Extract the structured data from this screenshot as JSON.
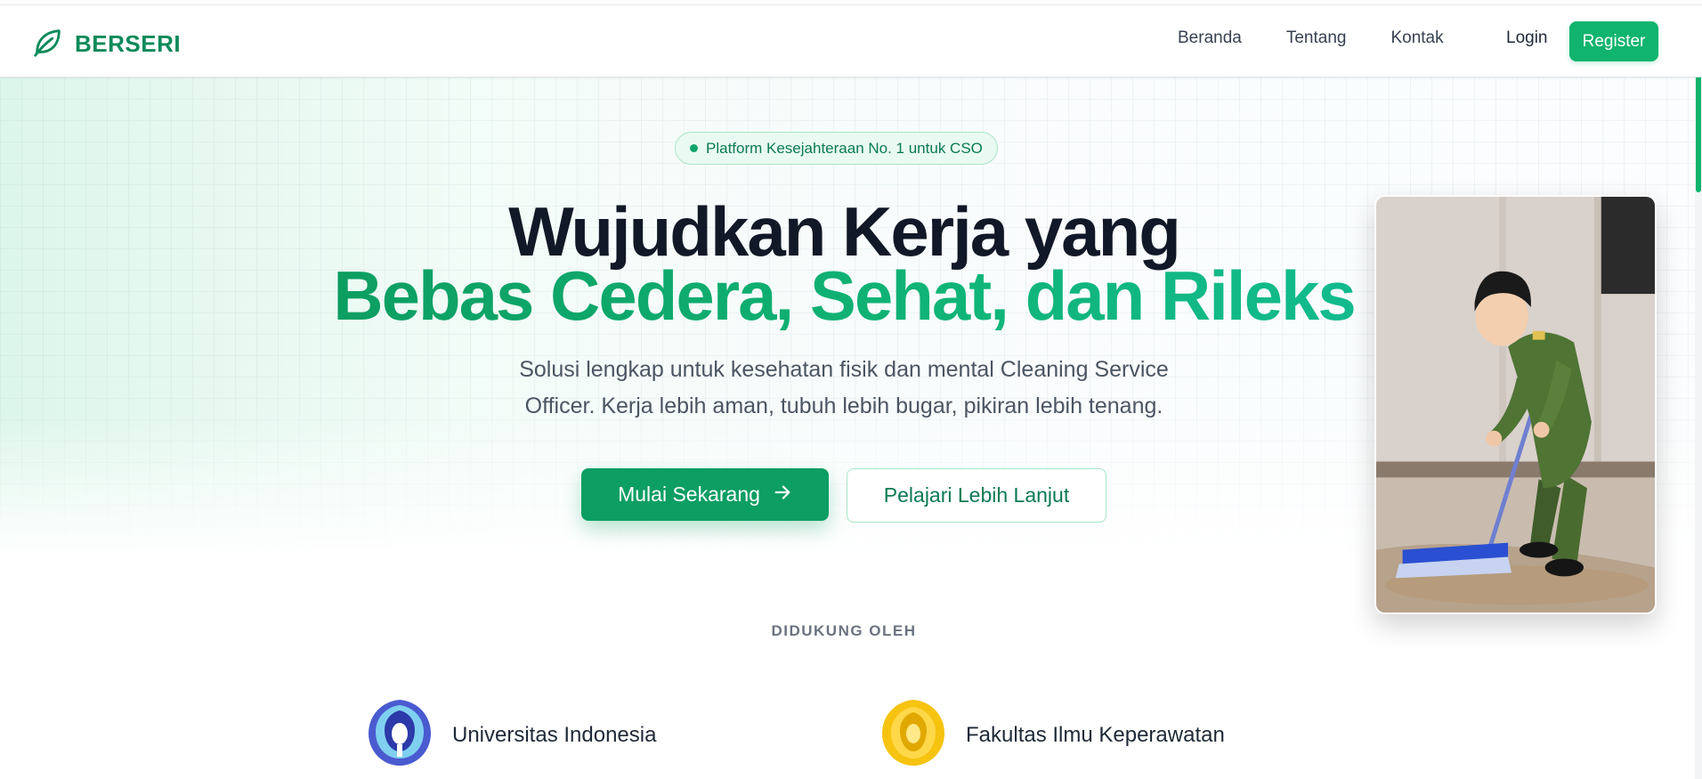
{
  "brand": {
    "name": "BERSERI",
    "icon": "leaf-icon"
  },
  "nav": {
    "links": [
      "Beranda",
      "Tentang",
      "Kontak"
    ],
    "login": "Login",
    "register": "Register"
  },
  "hero": {
    "badge": "Platform Kesejahteraan No. 1 untuk CSO",
    "headline_line1": "Wujudkan Kerja yang",
    "headline_line2": "Bebas Cedera, Sehat, dan Rileks",
    "subtitle": "Solusi lengkap untuk kesehatan fisik dan mental Cleaning Service Officer. Kerja lebih aman, tubuh lebih bugar, pikiran lebih tenang.",
    "primary_cta": "Mulai Sekarang",
    "primary_cta_icon": "arrow-right-icon",
    "secondary_cta": "Pelajari Lebih Lanjut",
    "illustration": "cleaning-officer-mopping-illustration"
  },
  "support": {
    "title": "DIDUKUNG OLEH",
    "partners": [
      {
        "name": "Universitas Indonesia",
        "logo": "ui-logo",
        "color": "#3b4bb3"
      },
      {
        "name": "Fakultas Ilmu Keperawatan",
        "logo": "fik-logo",
        "color": "#f2c012"
      }
    ]
  },
  "colors": {
    "primary": "#10b46e",
    "primary_dark": "#0c9e62",
    "headline": "#111827"
  }
}
